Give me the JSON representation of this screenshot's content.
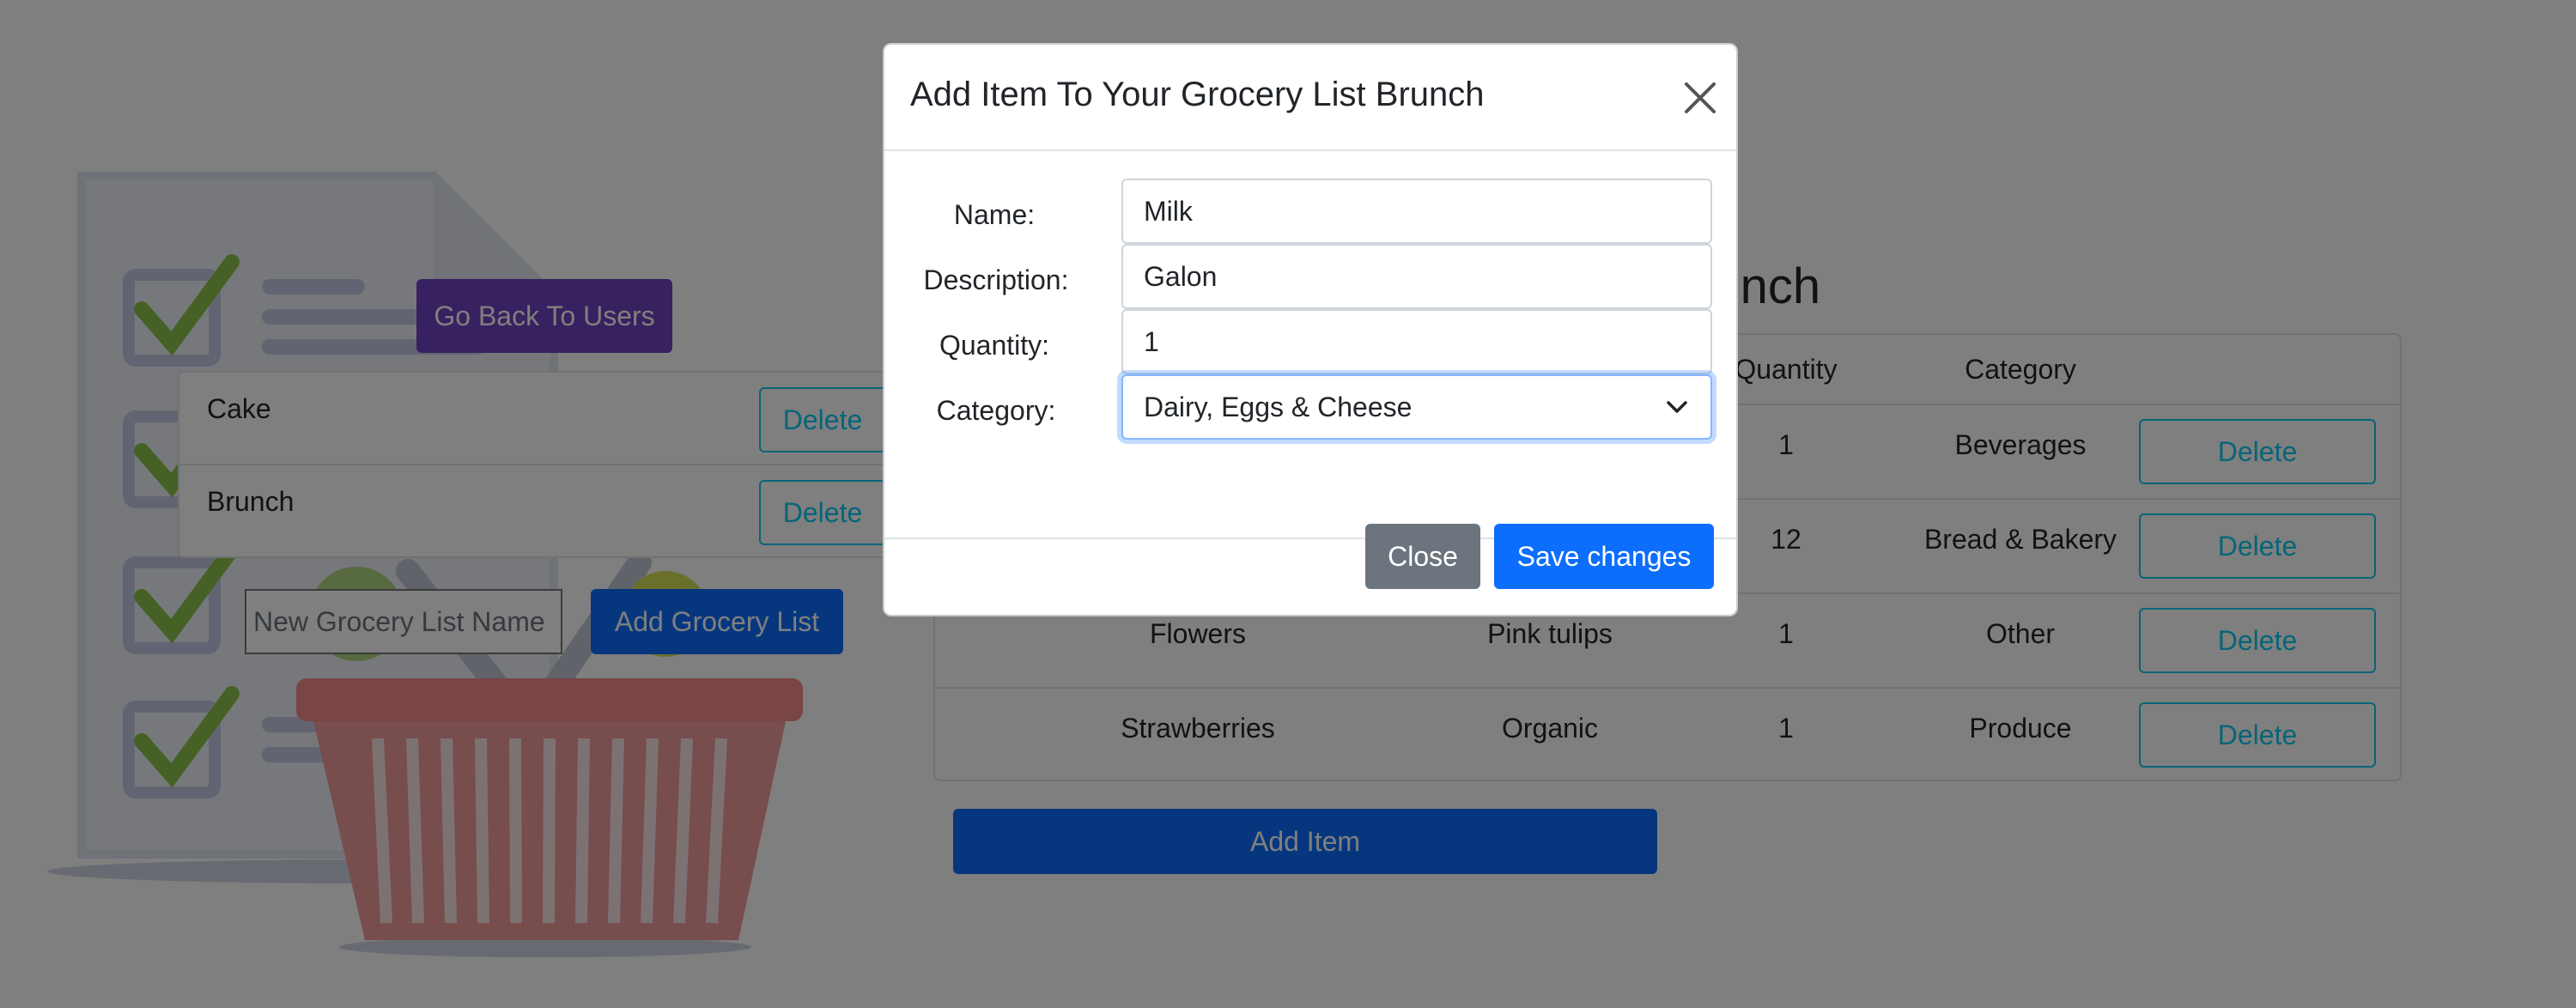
{
  "colors": {
    "primary": "#0d6efd",
    "secondary": "#6c757d",
    "purple": "#6f42c1",
    "info_outline": "#0dcaf0"
  },
  "left_panel": {
    "back_button_label": "Go Back To Users",
    "lists": [
      {
        "name": "Cake",
        "delete_label": "Delete"
      },
      {
        "name": "Brunch",
        "delete_label": "Delete"
      }
    ],
    "new_list_placeholder": "New Grocery List Name",
    "add_list_label": "Add Grocery List"
  },
  "main": {
    "title_visible": "runch",
    "table": {
      "headers": [
        "Quantity",
        "Category"
      ],
      "rows": [
        {
          "name": "",
          "description": "",
          "quantity": "1",
          "category": "Beverages",
          "delete_label": "Delete"
        },
        {
          "name": "",
          "description": "",
          "quantity": "12",
          "category": "Bread & Bakery",
          "delete_label": "Delete"
        },
        {
          "name": "Flowers",
          "description": "Pink tulips",
          "quantity": "1",
          "category": "Other",
          "delete_label": "Delete"
        },
        {
          "name": "Strawberries",
          "description": "Organic",
          "quantity": "1",
          "category": "Produce",
          "delete_label": "Delete"
        }
      ]
    },
    "add_item_label": "Add Item"
  },
  "modal": {
    "title": "Add Item To Your Grocery List Brunch",
    "close_icon": "close-icon",
    "fields": {
      "name": {
        "label": "Name:",
        "value": "Milk"
      },
      "description": {
        "label": "Description:",
        "value": "Galon"
      },
      "quantity": {
        "label": "Quantity:",
        "value": "1"
      },
      "category": {
        "label": "Category:",
        "value": "Dairy, Eggs & Cheese"
      }
    },
    "close_button_label": "Close",
    "save_button_label": "Save changes"
  }
}
